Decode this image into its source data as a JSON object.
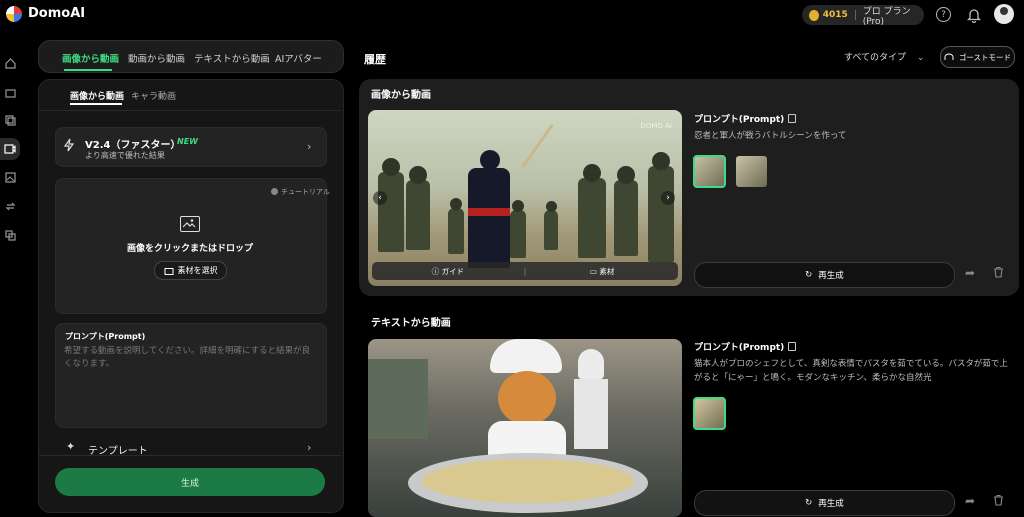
{
  "app": {
    "name": "DomoAI"
  },
  "header": {
    "credits": "4015",
    "plan": "プロ プラン(Pro)"
  },
  "tabs": [
    "画像から動画",
    "動画から動画",
    "テキストから動画",
    "AIアバター"
  ],
  "subtabs": [
    "画像から動画",
    "キャラ動画"
  ],
  "model": {
    "name": "V2.4（ファスター）",
    "badge": "NEW",
    "subtitle": "より高速で優れた結果"
  },
  "upload": {
    "tutorial": "チュートリアル",
    "title": "画像をクリックまたはドロップ",
    "select_button": "素材を選択"
  },
  "prompt": {
    "label": "プロンプト(Prompt)",
    "placeholder": "希望する動画を説明してください。詳細を明確にすると結果が良くなります。"
  },
  "template": {
    "label": "テンプレート"
  },
  "generate": {
    "label": "生成"
  },
  "history": {
    "title": "履歴",
    "filter": "すべてのタイプ",
    "ghost_button": "ゴーストモード",
    "items": [
      {
        "type": "画像から動画",
        "watermark": "DOMO AI",
        "guide_label": "ガイド",
        "material_label": "素材",
        "prompt_label": "プロンプト(Prompt)",
        "prompt_text": "忍者と軍人が戦うバトルシーンを作って",
        "regen_label": "再生成"
      },
      {
        "type": "テキストから動画",
        "prompt_label": "プロンプト(Prompt)",
        "prompt_text": "猫本人がプロのシェフとして、真剣な表情でパスタを茹でている。パスタが茹で上がると「にゃー」と鳴く。モダンなキッチン、柔らかな自然光",
        "regen_label": "再生成"
      }
    ]
  },
  "colors": {
    "accent": "#3ddc84",
    "generate_bg": "#1c7a45",
    "credit": "#f0c040"
  }
}
